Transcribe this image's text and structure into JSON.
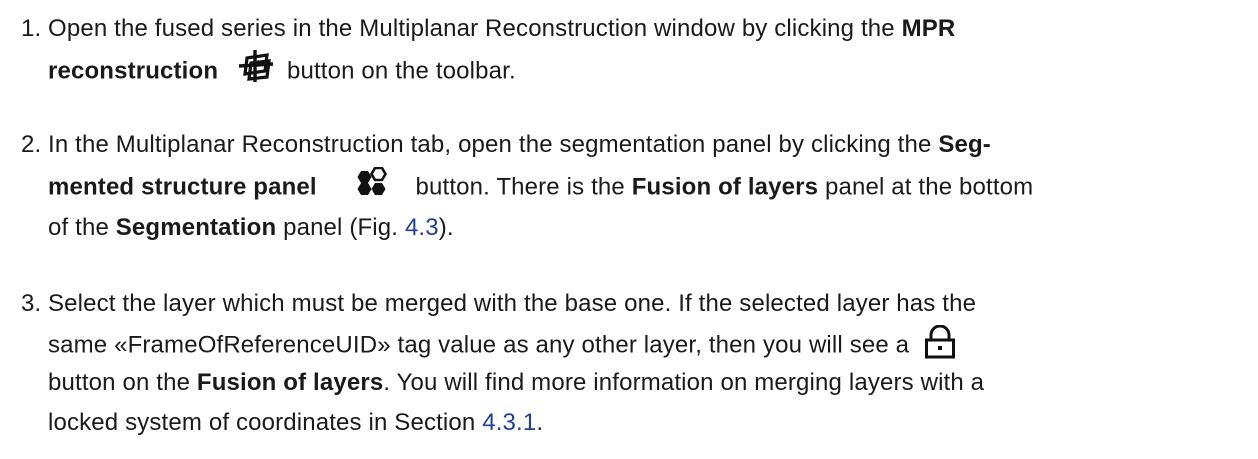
{
  "steps": [
    {
      "number": "1.",
      "line1": {
        "t1": "Open the fused series in the Multiplanar Reconstruction window by clicking the ",
        "b1": "MPR"
      },
      "line2": {
        "b1": "reconstruction",
        "t2": " button on the toolbar."
      },
      "icon": "mpr-reconstruction-icon"
    },
    {
      "number": "2.",
      "line1": {
        "t1": "In the Multiplanar Reconstruction tab, open the segmentation panel by clicking the ",
        "b1": "Seg-"
      },
      "line2": {
        "b1": "mented structure panel",
        "t2": " button. There is the ",
        "b2": "Fusion of layers",
        "t3": " panel at the bottom"
      },
      "line3": {
        "t1": "of the ",
        "b1": "Segmentation",
        "t2": " panel (Fig. ",
        "link1": "4.3",
        "t3": ")."
      },
      "icon": "segmented-structure-panel-icon"
    },
    {
      "number": "3.",
      "line1": {
        "t1": "Select the layer which must be merged with the base one. If the selected layer has the"
      },
      "line2": {
        "t1": "same «FrameOfReferenceUID» tag value as any other layer, then you will see a"
      },
      "line3": {
        "t1": "button on the ",
        "b1": "Fusion of layers",
        "t2": ". You will find more information on merging layers with a"
      },
      "line4": {
        "t1": "locked system of coordinates in Section ",
        "link1": "4.3.1",
        "t2": "."
      },
      "icon": "lock-icon"
    }
  ],
  "colors": {
    "text": "#1a1a1a",
    "link": "#1f3f9f",
    "background": "#ffffff"
  }
}
